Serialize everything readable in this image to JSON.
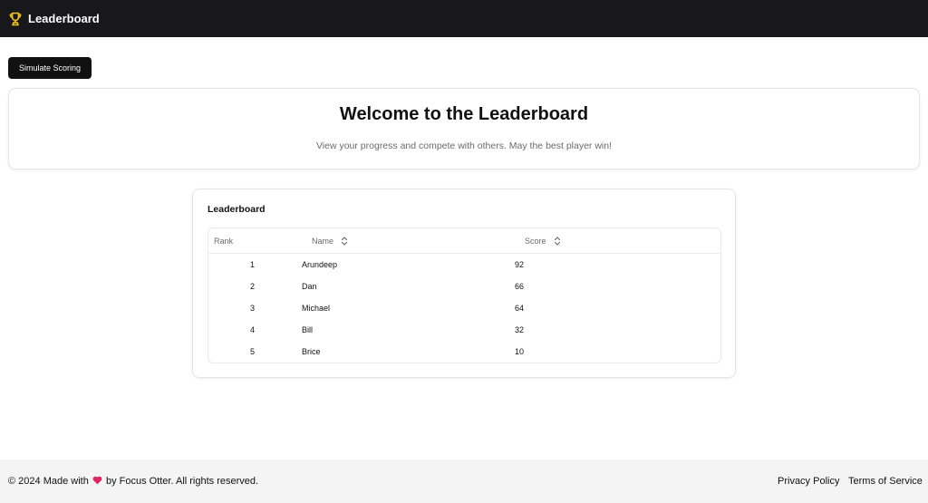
{
  "header": {
    "title": "Leaderboard",
    "icon": "trophy-icon",
    "icon_color": "#f5c518",
    "background": "#18181b"
  },
  "actions": {
    "simulate_label": "Simulate Scoring"
  },
  "welcome": {
    "title": "Welcome to the Leaderboard",
    "subtitle": "View your progress and compete with others. May the best player win!"
  },
  "leaderboard": {
    "heading": "Leaderboard",
    "columns": {
      "rank": "Rank",
      "name": "Name",
      "score": "Score"
    },
    "rows": [
      {
        "rank": "1",
        "name": "Arundeep",
        "score": "92"
      },
      {
        "rank": "2",
        "name": "Dan",
        "score": "66"
      },
      {
        "rank": "3",
        "name": "Michael",
        "score": "64"
      },
      {
        "rank": "4",
        "name": "Bill",
        "score": "32"
      },
      {
        "rank": "5",
        "name": "Brice",
        "score": "10"
      }
    ]
  },
  "footer": {
    "copyright_prefix": "© 2024 Made with",
    "heart_icon": "heart-icon",
    "heart_color": "#e0245e",
    "copyright_suffix": "by Focus Otter. All rights reserved.",
    "links": {
      "privacy": "Privacy Policy",
      "terms": "Terms of Service"
    }
  }
}
